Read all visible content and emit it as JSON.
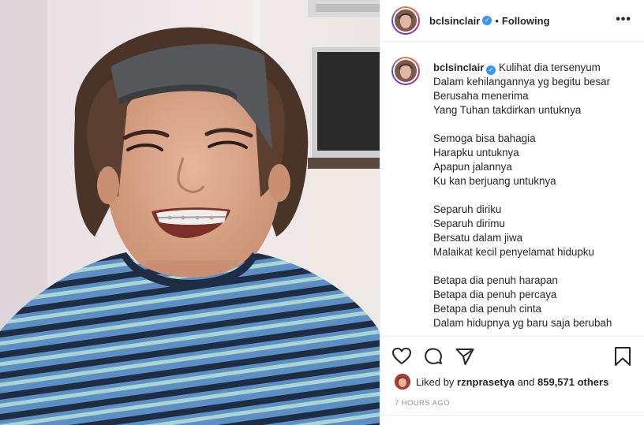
{
  "colors": {
    "text": "#262626",
    "muted": "#8e8e8e",
    "verified": "#3897f0",
    "divider": "#efefef"
  },
  "photo": {
    "icon": "portrait-photo"
  },
  "header": {
    "username": "bclsinclair",
    "separator": "•",
    "follow_status": "Following",
    "more_icon": "more-dots-icon",
    "more_label": "•••"
  },
  "caption": {
    "username": "bclsinclair",
    "lines": [
      "Kulihat dia tersenyum",
      "Dalam kehilangannya yg begitu besar",
      "Berusaha menerima",
      "Yang Tuhan takdirkan untuknya",
      "",
      "Semoga bisa bahagia",
      "Harapku untuknya",
      "Apapun jalannya",
      "Ku kan berjuang untuknya",
      "",
      "Separuh diriku",
      "Separuh dirimu",
      "Bersatu dalam jiwa",
      "Malaikat kecil penyelamat hidupku",
      "",
      "Betapa dia penuh harapan",
      "Betapa dia penuh percaya",
      "Betapa dia penuh cinta",
      "Dalam hidupnya yg baru saja berubah"
    ]
  },
  "actions": {
    "icons": [
      "heart-icon",
      "comment-icon",
      "share-icon",
      "bookmark-icon"
    ]
  },
  "likes": {
    "prefix": "Liked by",
    "user": "rznprasetya",
    "conjunction": "and",
    "count": "859,571 others"
  },
  "timestamp": "7 HOURS AGO"
}
